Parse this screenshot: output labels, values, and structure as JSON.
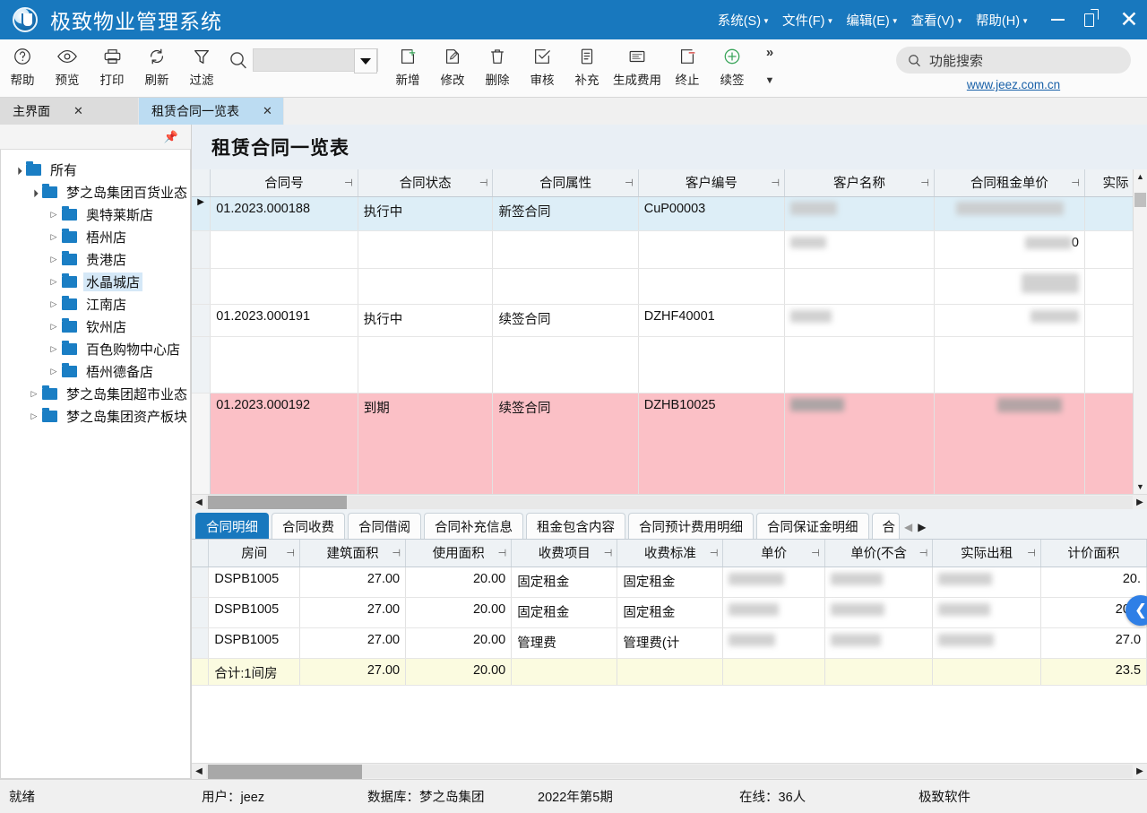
{
  "window": {
    "title": "极致物业管理系统",
    "logo_icon": "app-logo-icon",
    "menus": [
      {
        "label": "系统(S)",
        "key": "S"
      },
      {
        "label": "文件(F)",
        "key": "F"
      },
      {
        "label": "编辑(E)",
        "key": "E"
      },
      {
        "label": "查看(V)",
        "key": "V"
      },
      {
        "label": "帮助(H)",
        "key": "H"
      }
    ],
    "controls": {
      "minimize": "minimize-icon",
      "maximize": "maximize-icon",
      "close": "close-icon"
    }
  },
  "toolbar": {
    "buttons": [
      {
        "label": "帮助",
        "icon": "help-circle-icon"
      },
      {
        "label": "预览",
        "icon": "eye-icon"
      },
      {
        "label": "打印",
        "icon": "printer-icon"
      },
      {
        "label": "刷新",
        "icon": "refresh-icon"
      },
      {
        "label": "过滤",
        "icon": "filter-icon"
      }
    ],
    "search_combo": {
      "value": "",
      "placeholder": "",
      "icon": "search-icon",
      "dropdown_icon": "chevron-down-icon"
    },
    "buttons2": [
      {
        "label": "新增",
        "icon": "add-document-icon"
      },
      {
        "label": "修改",
        "icon": "edit-pencil-icon"
      },
      {
        "label": "删除",
        "icon": "trash-icon"
      },
      {
        "label": "审核",
        "icon": "check-box-icon"
      },
      {
        "label": "补充",
        "icon": "note-icon"
      },
      {
        "label": "生成费用",
        "icon": "invoice-icon"
      },
      {
        "label": "终止",
        "icon": "stop-document-icon"
      },
      {
        "label": "续签",
        "icon": "plus-circle-icon"
      }
    ],
    "overflow_icon": "chevron-double-right-icon",
    "overflow_down_icon": "chevron-down-icon",
    "func_search": {
      "placeholder": "功能搜索",
      "icon": "search-icon"
    },
    "site_link": "www.jeez.com.cn"
  },
  "doc_tabs": [
    {
      "label": "主界面",
      "active": false,
      "close_icon": "close-icon"
    },
    {
      "label": "租赁合同一览表",
      "active": true,
      "close_icon": "close-icon"
    }
  ],
  "sidebar": {
    "pin_icon": "pin-icon",
    "tree": [
      {
        "label": "所有",
        "depth": 0,
        "state": "open",
        "selected": false
      },
      {
        "label": "梦之岛集团百货业态",
        "depth": 1,
        "state": "open",
        "selected": false
      },
      {
        "label": "奥特莱斯店",
        "depth": 2,
        "state": "closed",
        "selected": false
      },
      {
        "label": "梧州店",
        "depth": 2,
        "state": "closed",
        "selected": false
      },
      {
        "label": "贵港店",
        "depth": 2,
        "state": "closed",
        "selected": false
      },
      {
        "label": "水晶城店",
        "depth": 2,
        "state": "closed",
        "selected": true
      },
      {
        "label": "江南店",
        "depth": 2,
        "state": "closed",
        "selected": false
      },
      {
        "label": "钦州店",
        "depth": 2,
        "state": "closed",
        "selected": false
      },
      {
        "label": "百色购物中心店",
        "depth": 2,
        "state": "closed",
        "selected": false
      },
      {
        "label": "梧州德备店",
        "depth": 2,
        "state": "closed",
        "selected": false
      },
      {
        "label": "梦之岛集团超市业态",
        "depth": 1,
        "state": "closed",
        "selected": false
      },
      {
        "label": "梦之岛集团资产板块",
        "depth": 1,
        "state": "closed",
        "selected": false
      }
    ]
  },
  "main": {
    "page_title": "租赁合同一览表",
    "grid": {
      "columns": [
        {
          "label": "合同号",
          "filter_icon": "filter-pin-icon"
        },
        {
          "label": "合同状态",
          "filter_icon": "filter-pin-icon"
        },
        {
          "label": "合同属性",
          "filter_icon": "filter-pin-icon"
        },
        {
          "label": "客户编号",
          "filter_icon": "filter-pin-icon"
        },
        {
          "label": "客户名称",
          "filter_icon": "filter-pin-icon"
        },
        {
          "label": "合同租金单价",
          "filter_icon": "filter-pin-icon"
        },
        {
          "label": "实际",
          "filter_icon": "sort-asc-icon"
        }
      ],
      "rows": [
        {
          "style": "selected",
          "marker": true,
          "cells": [
            "01.2023.000188",
            "执行中",
            "新签合同",
            "CuP00003",
            "",
            "",
            ""
          ]
        },
        {
          "style": "normal",
          "marker": false,
          "cells": [
            "",
            "",
            "",
            "",
            "",
            "0",
            ""
          ]
        },
        {
          "style": "normal",
          "marker": false,
          "cells": [
            "",
            "",
            "",
            "",
            "",
            "",
            ""
          ]
        },
        {
          "style": "normal",
          "marker": false,
          "cells": [
            "01.2023.000191",
            "执行中",
            "续签合同",
            "DZHF40001",
            "",
            "",
            ""
          ]
        },
        {
          "style": "normal",
          "marker": false,
          "cells": [
            "",
            "",
            "",
            "",
            "",
            "",
            ""
          ]
        },
        {
          "style": "pink",
          "marker": false,
          "cells": [
            "01.2023.000192",
            "到期",
            "续签合同",
            "DZHB10025",
            "",
            "",
            ""
          ]
        }
      ]
    },
    "hscroll": {
      "left_icon": "arrow-left-icon",
      "right_icon": "arrow-right-icon"
    },
    "vscroll": {
      "up_icon": "arrow-up-icon",
      "down_icon": "arrow-down-icon"
    }
  },
  "detail": {
    "tabs": [
      {
        "label": "合同明细",
        "active": true
      },
      {
        "label": "合同收费",
        "active": false
      },
      {
        "label": "合同借阅",
        "active": false
      },
      {
        "label": "合同补充信息",
        "active": false
      },
      {
        "label": "租金包含内容",
        "active": false
      },
      {
        "label": "合同预计费用明细",
        "active": false
      },
      {
        "label": "合同保证金明细",
        "active": false
      },
      {
        "label": "合",
        "active": false
      }
    ],
    "tab_nav": {
      "prev_icon": "chevron-left-icon",
      "next_icon": "chevron-right-icon"
    },
    "grid": {
      "columns": [
        {
          "label": "房间",
          "filter_icon": "filter-pin-icon"
        },
        {
          "label": "建筑面积",
          "filter_icon": "filter-pin-icon"
        },
        {
          "label": "使用面积",
          "filter_icon": "filter-pin-icon"
        },
        {
          "label": "收费项目",
          "filter_icon": "filter-pin-icon"
        },
        {
          "label": "收费标准",
          "filter_icon": "filter-pin-icon"
        },
        {
          "label": "单价",
          "filter_icon": "filter-pin-icon"
        },
        {
          "label": "单价(不含",
          "filter_icon": "filter-pin-icon"
        },
        {
          "label": "实际出租",
          "filter_icon": "filter-pin-icon"
        },
        {
          "label": "计价面积",
          "filter_icon": "filter-pin-icon"
        }
      ],
      "rows": [
        {
          "style": "normal",
          "cells": [
            "DSPB1005",
            "27.00",
            "20.00",
            "固定租金",
            "固定租金",
            "",
            "",
            "",
            "20."
          ]
        },
        {
          "style": "normal",
          "cells": [
            "DSPB1005",
            "27.00",
            "20.00",
            "固定租金",
            "固定租金",
            "",
            "",
            "",
            "20.0"
          ]
        },
        {
          "style": "normal",
          "cells": [
            "DSPB1005",
            "27.00",
            "20.00",
            "管理费",
            "管理费(计",
            "",
            "",
            "",
            "27.0"
          ]
        },
        {
          "style": "total",
          "cells": [
            "合计:1间房",
            "27.00",
            "20.00",
            "",
            "",
            "",
            "",
            "",
            "23.5"
          ]
        }
      ]
    },
    "fab_icon": "chevron-left-circle-icon",
    "hscroll": {
      "left_icon": "arrow-left-icon",
      "right_icon": "arrow-right-icon"
    }
  },
  "statusbar": {
    "ready": "就绪",
    "user": "用户：jeez",
    "database": "数据库：梦之岛集团",
    "period": "2022年第5期",
    "online": "在线：36人",
    "vendor": "极致软件"
  },
  "colors": {
    "titlebar": "#1878be",
    "accent": "#1878be",
    "selected_row": "#ddeef7",
    "expired_row": "#fbc0c6",
    "total_row": "#fbfbe0",
    "header": "#eef2f5",
    "link": "#1860a8"
  }
}
